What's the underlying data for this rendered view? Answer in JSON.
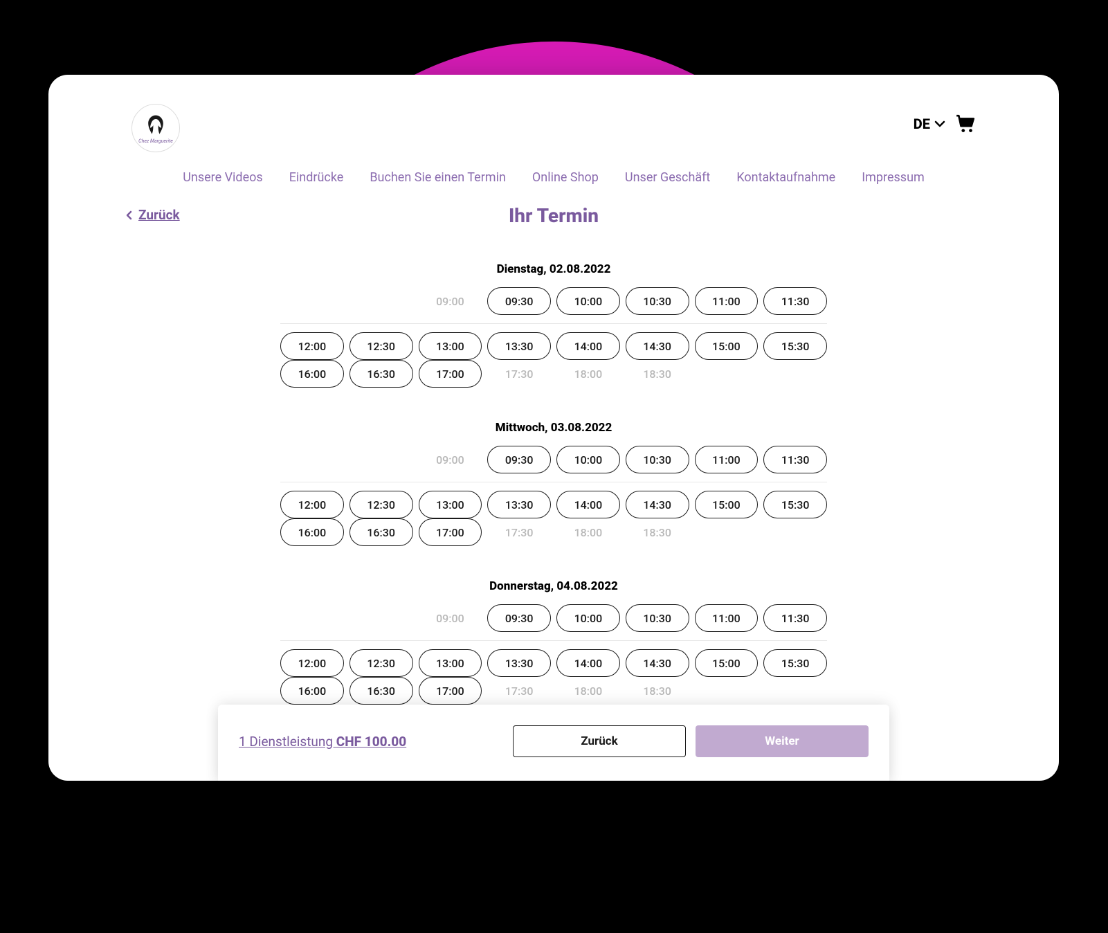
{
  "header": {
    "logo_caption": "Chez Marguerite",
    "language": "DE",
    "nav": [
      "Unsere Videos",
      "Eindrücke",
      "Buchen Sie einen Termin",
      "Online Shop",
      "Unser Geschäft",
      "Kontaktaufnahme",
      "Impressum"
    ]
  },
  "page": {
    "back_label": "Zurück",
    "title": "Ihr Termin"
  },
  "days": [
    {
      "label": "Dienstag, 02.08.2022",
      "row1": [
        {
          "t": "09:00",
          "e": false
        },
        {
          "t": "09:30",
          "e": true
        },
        {
          "t": "10:00",
          "e": true
        },
        {
          "t": "10:30",
          "e": true
        },
        {
          "t": "11:00",
          "e": true
        },
        {
          "t": "11:30",
          "e": true
        }
      ],
      "row2": [
        {
          "t": "12:00",
          "e": true
        },
        {
          "t": "12:30",
          "e": true
        },
        {
          "t": "13:00",
          "e": true
        },
        {
          "t": "13:30",
          "e": true
        },
        {
          "t": "14:00",
          "e": true
        },
        {
          "t": "14:30",
          "e": true
        },
        {
          "t": "15:00",
          "e": true
        },
        {
          "t": "15:30",
          "e": true
        }
      ],
      "row3": [
        {
          "t": "16:00",
          "e": true
        },
        {
          "t": "16:30",
          "e": true
        },
        {
          "t": "17:00",
          "e": true
        },
        {
          "t": "17:30",
          "e": false
        },
        {
          "t": "18:00",
          "e": false
        },
        {
          "t": "18:30",
          "e": false
        }
      ]
    },
    {
      "label": "Mittwoch, 03.08.2022",
      "row1": [
        {
          "t": "09:00",
          "e": false
        },
        {
          "t": "09:30",
          "e": true
        },
        {
          "t": "10:00",
          "e": true
        },
        {
          "t": "10:30",
          "e": true
        },
        {
          "t": "11:00",
          "e": true
        },
        {
          "t": "11:30",
          "e": true
        }
      ],
      "row2": [
        {
          "t": "12:00",
          "e": true
        },
        {
          "t": "12:30",
          "e": true
        },
        {
          "t": "13:00",
          "e": true
        },
        {
          "t": "13:30",
          "e": true
        },
        {
          "t": "14:00",
          "e": true
        },
        {
          "t": "14:30",
          "e": true
        },
        {
          "t": "15:00",
          "e": true
        },
        {
          "t": "15:30",
          "e": true
        }
      ],
      "row3": [
        {
          "t": "16:00",
          "e": true
        },
        {
          "t": "16:30",
          "e": true
        },
        {
          "t": "17:00",
          "e": true
        },
        {
          "t": "17:30",
          "e": false
        },
        {
          "t": "18:00",
          "e": false
        },
        {
          "t": "18:30",
          "e": false
        }
      ]
    },
    {
      "label": "Donnerstag, 04.08.2022",
      "row1": [
        {
          "t": "09:00",
          "e": false
        },
        {
          "t": "09:30",
          "e": true
        },
        {
          "t": "10:00",
          "e": true
        },
        {
          "t": "10:30",
          "e": true
        },
        {
          "t": "11:00",
          "e": true
        },
        {
          "t": "11:30",
          "e": true
        }
      ],
      "row2": [
        {
          "t": "12:00",
          "e": true
        },
        {
          "t": "12:30",
          "e": true
        },
        {
          "t": "13:00",
          "e": true
        },
        {
          "t": "13:30",
          "e": true
        },
        {
          "t": "14:00",
          "e": true
        },
        {
          "t": "14:30",
          "e": true
        },
        {
          "t": "15:00",
          "e": true
        },
        {
          "t": "15:30",
          "e": true
        }
      ],
      "row3": [
        {
          "t": "16:00",
          "e": true
        },
        {
          "t": "16:30",
          "e": true
        },
        {
          "t": "17:00",
          "e": true
        },
        {
          "t": "17:30",
          "e": false
        },
        {
          "t": "18:00",
          "e": false
        },
        {
          "t": "18:30",
          "e": false
        }
      ]
    }
  ],
  "footer": {
    "summary_prefix": "1 Dienstleistung ",
    "summary_price": "CHF 100.00",
    "back": "Zurück",
    "next": "Weiter"
  }
}
